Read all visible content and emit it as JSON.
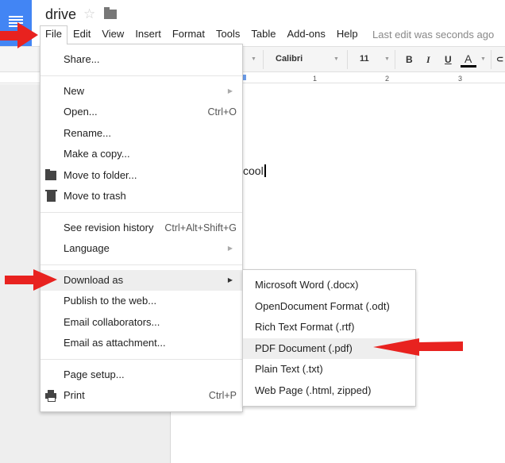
{
  "header": {
    "doc_title": "drive",
    "star_icon": "star-outline-icon",
    "folder_icon": "folder-icon",
    "last_edit": "Last edit was seconds ago"
  },
  "menubar": {
    "items": [
      {
        "label": "File",
        "active": true
      },
      {
        "label": "Edit"
      },
      {
        "label": "View"
      },
      {
        "label": "Insert"
      },
      {
        "label": "Format"
      },
      {
        "label": "Tools"
      },
      {
        "label": "Table"
      },
      {
        "label": "Add-ons"
      },
      {
        "label": "Help"
      }
    ]
  },
  "toolbar": {
    "font": "Calibri",
    "font_size": "11",
    "bold": "B",
    "italic": "I",
    "underline": "U",
    "text_color": "A",
    "text_color_value": "#000000"
  },
  "ruler": {
    "ticks": [
      "1",
      "2",
      "3"
    ]
  },
  "document": {
    "body_text": "cool"
  },
  "file_menu": {
    "items": [
      {
        "label": "Share..."
      },
      {
        "label": "New",
        "submenu": true
      },
      {
        "label": "Open...",
        "shortcut": "Ctrl+O"
      },
      {
        "label": "Rename..."
      },
      {
        "label": "Make a copy..."
      },
      {
        "label": "Move to folder...",
        "icon": "folder-icon"
      },
      {
        "label": "Move to trash",
        "icon": "trash-icon"
      },
      {
        "label": "See revision history",
        "shortcut": "Ctrl+Alt+Shift+G"
      },
      {
        "label": "Language",
        "submenu": true
      },
      {
        "label": "Download as",
        "submenu": true,
        "highlighted": true
      },
      {
        "label": "Publish to the web..."
      },
      {
        "label": "Email collaborators..."
      },
      {
        "label": "Email as attachment..."
      },
      {
        "label": "Page setup..."
      },
      {
        "label": "Print",
        "shortcut": "Ctrl+P",
        "icon": "print-icon"
      }
    ]
  },
  "download_submenu": {
    "items": [
      {
        "label": "Microsoft Word (.docx)"
      },
      {
        "label": "OpenDocument Format (.odt)"
      },
      {
        "label": "Rich Text Format (.rtf)"
      },
      {
        "label": "PDF Document (.pdf)",
        "highlighted": true
      },
      {
        "label": "Plain Text (.txt)"
      },
      {
        "label": "Web Page (.html, zipped)"
      }
    ]
  },
  "colors": {
    "brand_blue": "#4285f4",
    "annotation_red": "#e8221f",
    "highlight": "#eeeeee"
  }
}
